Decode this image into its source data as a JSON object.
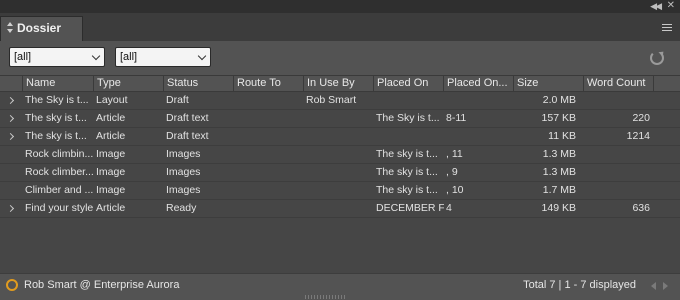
{
  "panel": {
    "tab_label": "Dossier",
    "icons": [
      "collapse-icon",
      "close-icon",
      "panel-menu-icon",
      "refresh-icon"
    ]
  },
  "filters": {
    "filter1": "[all]",
    "filter2": "[all]"
  },
  "table": {
    "columns": [
      "Name",
      "Type",
      "Status",
      "Route To",
      "In Use By",
      "Placed On",
      "Placed On...",
      "Size",
      "Word Count"
    ],
    "rows": [
      {
        "expandable": true,
        "name": "The Sky is t...",
        "type": "Layout",
        "status": "Draft",
        "route_to": "",
        "in_use_by": "Rob Smart",
        "placed_on": "",
        "placed_on_page": "",
        "size": "2.0 MB",
        "word_count": ""
      },
      {
        "expandable": true,
        "name": "The sky is t...",
        "type": "Article",
        "status": "Draft text",
        "route_to": "",
        "in_use_by": "",
        "placed_on": "The Sky is t...",
        "placed_on_page": "8-11",
        "size": "157 KB",
        "word_count": "220"
      },
      {
        "expandable": true,
        "name": "The sky is t...",
        "type": "Article",
        "status": "Draft text",
        "route_to": "",
        "in_use_by": "",
        "placed_on": "",
        "placed_on_page": "",
        "size": "11 KB",
        "word_count": "1214"
      },
      {
        "expandable": false,
        "name": "Rock climbin...",
        "type": "Image",
        "status": "Images",
        "route_to": "",
        "in_use_by": "",
        "placed_on": "The sky is t...",
        "placed_on_page": ", 11",
        "size": "1.3 MB",
        "word_count": ""
      },
      {
        "expandable": false,
        "name": "Rock climber...",
        "type": "Image",
        "status": "Images",
        "route_to": "",
        "in_use_by": "",
        "placed_on": "The sky is t...",
        "placed_on_page": ", 9",
        "size": "1.3 MB",
        "word_count": ""
      },
      {
        "expandable": false,
        "name": "Climber and ...",
        "type": "Image",
        "status": "Images",
        "route_to": "",
        "in_use_by": "",
        "placed_on": "The sky is t...",
        "placed_on_page": ", 10",
        "size": "1.7 MB",
        "word_count": ""
      },
      {
        "expandable": true,
        "name": "Find your style",
        "type": "Article",
        "status": "Ready",
        "route_to": "",
        "in_use_by": "",
        "placed_on": "DECEMBER F...",
        "placed_on_page": "4",
        "size": "149 KB",
        "word_count": "636"
      }
    ]
  },
  "status": {
    "user": "Rob Smart @ Enterprise Aurora",
    "count": "Total 7 | 1 - 7 displayed",
    "indicator_color": "#e09b1f"
  }
}
